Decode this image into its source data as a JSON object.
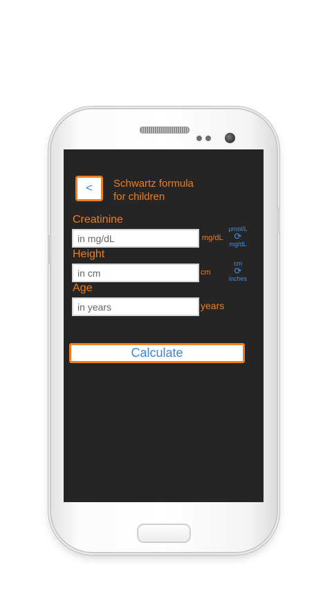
{
  "app": {
    "back_label": "<",
    "title_line1": "Schwartz formula",
    "title_line2": "for children"
  },
  "fields": {
    "creatinine": {
      "label": "Creatinine",
      "placeholder": "in mg/dL",
      "unit": "mg/dL",
      "toggle_top": "µmol/L",
      "toggle_bottom": "mg/dL"
    },
    "height": {
      "label": "Height",
      "placeholder": "in cm",
      "unit": "cm",
      "toggle_top": "cm",
      "toggle_bottom": "inches"
    },
    "age": {
      "label": "Age",
      "placeholder": "in years",
      "unit": "years"
    }
  },
  "actions": {
    "calculate_label": "Calculate"
  },
  "icons": {
    "unit_toggle": "refresh-icon",
    "back": "chevron-left-icon"
  },
  "colors": {
    "accent_orange": "#f07d1e",
    "accent_blue": "#3a86d8",
    "screen_bg": "#252525"
  }
}
